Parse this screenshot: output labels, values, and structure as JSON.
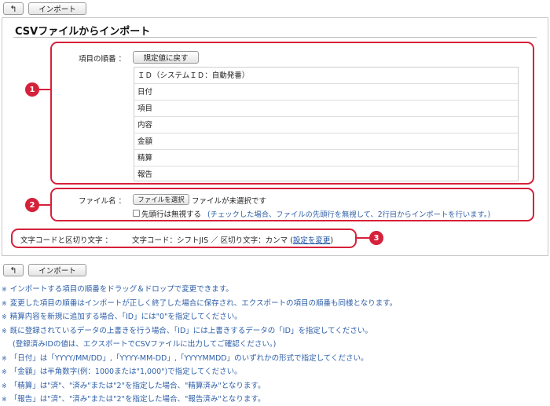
{
  "toolbar": {
    "back_symbol": "↰",
    "import_label": "インポート"
  },
  "panel": {
    "title": "CSVファイルからインポート"
  },
  "badges": [
    "1",
    "2",
    "3"
  ],
  "order_section": {
    "label": "項目の順番 ：",
    "reset_label": "規定値に戻す",
    "items": [
      "ＩＤ（システムＩＤ：自動発番）",
      "日付",
      "項目",
      "内容",
      "金額",
      "精算",
      "報告"
    ]
  },
  "file_section": {
    "label": "ファイル名 ：",
    "choose_label": "ファイルを選択",
    "no_file_text": "ファイルが未選択です",
    "skip_header_label": "先頭行は無視する",
    "skip_header_note": "(チェックした場合、ファイルの先頭行を無視して、2行目からインポートを行います。)"
  },
  "encoding_section": {
    "label": "文字コードと区切り文字 ：",
    "value_text": "文字コード：シフトJIS ／ 区切り文字：カンマ (",
    "change_link": "設定を変更",
    "close_paren": ")"
  },
  "notes": [
    {
      "mark": "※",
      "text": "インポートする項目の順番をドラッグ＆ドロップで変更できます。"
    },
    {
      "mark": "※",
      "text": "変更した項目の順番はインポートが正しく終了した場合に保存され、エクスポートの項目の順番も同様となります。"
    },
    {
      "mark": "※",
      "text": "精算内容を新規に追加する場合、「ID」には\"0\"を指定してください。"
    },
    {
      "mark": "※",
      "text": "既に登録されているデータの上書きを行う場合、「ID」には上書きするデータの「ID」を指定してください。"
    },
    {
      "mark": "",
      "text": "(登録済みIDの値は、エクスポートでCSVファイルに出力してご確認ください。)"
    },
    {
      "mark": "※",
      "text": "「日付」は「YYYY/MM/DD」,「YYYY-MM-DD」,「YYYYMMDD」のいずれかの形式で指定してください。"
    },
    {
      "mark": "※",
      "text": "「金額」は半角数字(例：1000または\"1,000\")で指定してください。"
    },
    {
      "mark": "※",
      "text": "「精算」は\"済\"、\"済み\"または\"2\"を指定した場合、\"精算済み\"となります。"
    },
    {
      "mark": "※",
      "text": "「報告」は\"済\"、\"済み\"または\"2\"を指定した場合、\"報告済み\"となります。"
    }
  ]
}
